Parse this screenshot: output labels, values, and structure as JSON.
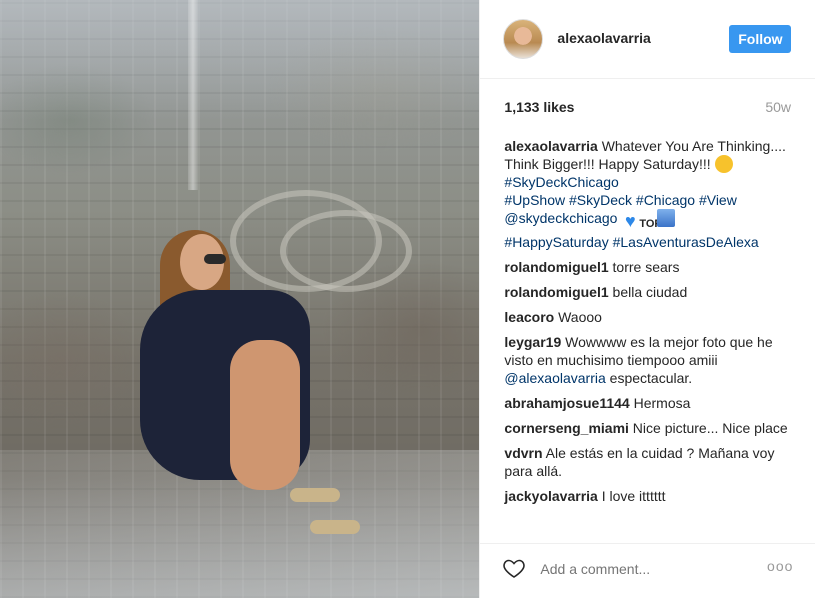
{
  "post": {
    "username": "alexaolavarria",
    "follow_label": "Follow",
    "likes": "1,133 likes",
    "age": "50w",
    "caption": {
      "user": "alexaolavarria",
      "text": "Whatever You Are Thinking.... Think Bigger!!! Happy Saturday!!!",
      "tags_1": "#SkyDeckChicago",
      "tags_2": "#UpShow #SkyDeck #Chicago #View @skydeckchicago",
      "tags_3": "#HappySaturday #LasAventurasDeAlexa",
      "emoji_top_label": "TOP"
    },
    "comments": [
      {
        "user": "rolandomiguel1",
        "text": "torre sears"
      },
      {
        "user": "rolandomiguel1",
        "text": "bella ciudad"
      },
      {
        "user": "leacoro",
        "text": "Waooo"
      },
      {
        "user": "leygar19",
        "text": "Wowwww es la mejor foto que he visto en muchisimo tiempooo amiii",
        "mention": "@alexaolavarria",
        "text_after": "espectacular."
      },
      {
        "user": "abrahamjosue1144",
        "text": "Hermosa"
      },
      {
        "user": "cornerseng_miami",
        "text": "Nice picture... Nice place"
      },
      {
        "user": "vdvrn",
        "text": "Ale estás en la cuidad ? Mañana voy para allá."
      },
      {
        "user": "jackyolavarria",
        "text": "I love itttttt"
      }
    ],
    "add_comment_placeholder": "Add a comment...",
    "more_label": "ooo"
  },
  "icons": {
    "like": "heart-outline-icon",
    "more": "more-options-icon"
  },
  "colors": {
    "accent": "#3897f0",
    "tag": "#003569",
    "muted": "#999999",
    "text": "#262626"
  }
}
